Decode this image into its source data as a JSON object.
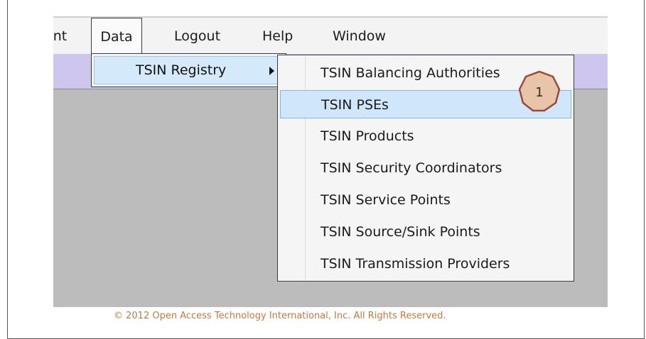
{
  "menubar": {
    "items": [
      "ent",
      "Data",
      "Logout",
      "Help",
      "Window"
    ]
  },
  "data_menu": {
    "registry_label": "TSIN Registry"
  },
  "submenu": {
    "items": [
      "TSIN Balancing Authorities",
      "TSIN PSEs",
      "TSIN Products",
      "TSIN Security Coordinators",
      "TSIN Service Points",
      "TSIN Source/Sink Points",
      "TSIN Transmission Providers"
    ],
    "highlighted_index": 1
  },
  "callout": {
    "number": "1",
    "fill": "#e8c4a8",
    "stroke": "#9a4a3a"
  },
  "footer": {
    "copyright": "© 2012 Open Access Technology International, Inc. All Rights Reserved."
  },
  "colors": {
    "tool_strip": "#cfc6ef",
    "highlight": "#cfe6fb",
    "background_gray": "#bcbcbc"
  }
}
